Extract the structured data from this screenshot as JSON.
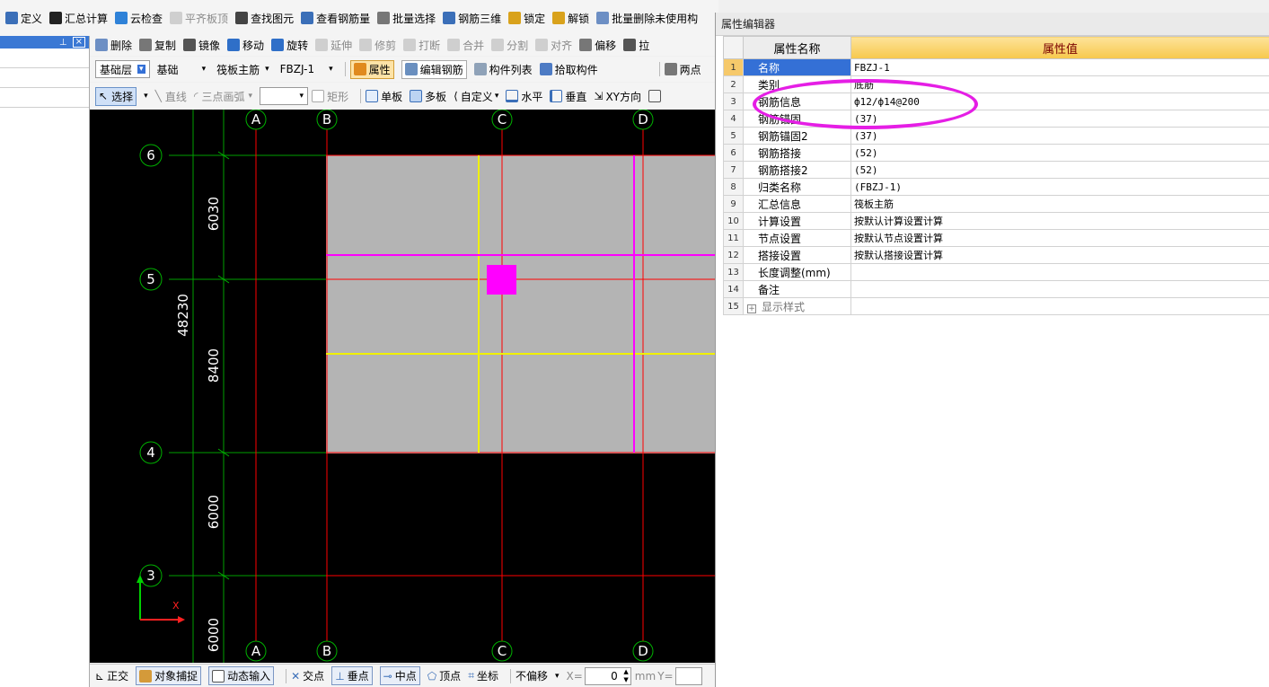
{
  "toolbar1": {
    "items": [
      {
        "label": "定义",
        "icon": "define-icon"
      },
      {
        "label": "汇总计算",
        "icon": "sigma-icon"
      },
      {
        "label": "云检查",
        "icon": "cloud-check-icon"
      },
      {
        "label": "平齐板顶",
        "icon": "flush-slab-icon",
        "disabled": true
      },
      {
        "label": "查找图元",
        "icon": "binoculars-icon"
      },
      {
        "label": "查看钢筋量",
        "icon": "view-rebar-icon"
      },
      {
        "label": "批量选择",
        "icon": "batch-select-icon"
      },
      {
        "label": "钢筋三维",
        "icon": "rebar-3d-icon"
      },
      {
        "label": "锁定",
        "icon": "lock-icon"
      },
      {
        "label": "解锁",
        "icon": "unlock-icon"
      },
      {
        "label": "批量删除未使用构",
        "icon": "batch-delete-icon"
      }
    ]
  },
  "left_panel": {
    "pin": "⊥",
    "close": "×"
  },
  "toolbar2": {
    "items": [
      {
        "label": "删除",
        "icon": "delete-icon"
      },
      {
        "label": "复制",
        "icon": "copy-icon"
      },
      {
        "label": "镜像",
        "icon": "mirror-icon"
      },
      {
        "label": "移动",
        "icon": "move-icon"
      },
      {
        "label": "旋转",
        "icon": "rotate-icon"
      },
      {
        "label": "延伸",
        "icon": "extend-icon",
        "disabled": true
      },
      {
        "label": "修剪",
        "icon": "trim-icon",
        "disabled": true
      },
      {
        "label": "打断",
        "icon": "break-icon",
        "disabled": true
      },
      {
        "label": "合并",
        "icon": "merge-icon",
        "disabled": true
      },
      {
        "label": "分割",
        "icon": "split-icon",
        "disabled": true
      },
      {
        "label": "对齐",
        "icon": "align-icon",
        "disabled": true
      },
      {
        "label": "偏移",
        "icon": "offset-icon"
      },
      {
        "label": "拉",
        "icon": "stretch-icon"
      }
    ]
  },
  "toolbar3": {
    "layer": "基础层",
    "category": "基础",
    "type": "筏板主筋",
    "component": "FBZJ-1",
    "property_button": "属性",
    "edit_rebar_button": "编辑钢筋",
    "component_list_button": "构件列表",
    "pick_component_button": "拾取构件",
    "two_points_button": "两点"
  },
  "toolbar4": {
    "select": "选择",
    "line": "直线",
    "arc": "三点画弧",
    "rect": "矩形",
    "single_slab": "单板",
    "multi_slab": "多板",
    "custom": "自定义",
    "horizontal": "水平",
    "vertical": "垂直",
    "xy_direction": "XY方向"
  },
  "canvas": {
    "col_labels": [
      "A",
      "B",
      "C",
      "D"
    ],
    "row_labels": [
      "6",
      "5",
      "4",
      "3"
    ],
    "dim_total": "48230",
    "dims": [
      "6030",
      "8400",
      "6000",
      "6000"
    ],
    "axis_x_label": "X",
    "colors": {
      "background": "#000000",
      "slab": "#b4b4b4",
      "axis_line": "#ff0000",
      "dim_line": "#00b000",
      "rebar_yellow": "#f0f000",
      "rebar_magenta": "#ff00ff",
      "label_text": "#ffffff"
    }
  },
  "status_bar": {
    "ortho": "正交",
    "object_snap": "对象捕捉",
    "dynamic_input": "动态输入",
    "intersection": "交点",
    "perpendicular": "垂点",
    "midpoint": "中点",
    "vertex": "顶点",
    "coordinate": "坐标",
    "offset_mode": "不偏移",
    "x_label": "X=",
    "x_value": "0",
    "unit": "mm",
    "y_label": "Y="
  },
  "property_editor": {
    "title": "属性编辑器",
    "col_name": "属性名称",
    "col_value": "属性值",
    "rows": [
      {
        "num": "1",
        "name": "名称",
        "value": "FBZJ-1"
      },
      {
        "num": "2",
        "name": "类别",
        "value": "底筋"
      },
      {
        "num": "3",
        "name": "钢筋信息",
        "value": "ф12/ф14@200"
      },
      {
        "num": "4",
        "name": "钢筋锚固",
        "value": "(37)"
      },
      {
        "num": "5",
        "name": "钢筋锚固2",
        "value": "(37)"
      },
      {
        "num": "6",
        "name": "钢筋搭接",
        "value": "(52)"
      },
      {
        "num": "7",
        "name": "钢筋搭接2",
        "value": "(52)"
      },
      {
        "num": "8",
        "name": "归类名称",
        "value": "(FBZJ-1)"
      },
      {
        "num": "9",
        "name": "汇总信息",
        "value": "筏板主筋"
      },
      {
        "num": "10",
        "name": "计算设置",
        "value": "按默认计算设置计算"
      },
      {
        "num": "11",
        "name": "节点设置",
        "value": "按默认节点设置计算"
      },
      {
        "num": "12",
        "name": "搭接设置",
        "value": "按默认搭接设置计算"
      },
      {
        "num": "13",
        "name": "长度调整(mm)",
        "value": ""
      },
      {
        "num": "14",
        "name": "备注",
        "value": ""
      },
      {
        "num": "15",
        "name": "显示样式",
        "value": ""
      }
    ],
    "highlight_color": "#e51ee5"
  }
}
